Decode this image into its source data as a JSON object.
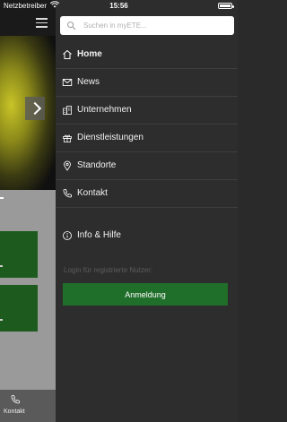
{
  "status_bar": {
    "carrier": "Netzbetreiber",
    "time": "15:56"
  },
  "background": {
    "tabbar": {
      "contact_label": "Kontakt"
    }
  },
  "drawer": {
    "search": {
      "placeholder": "Suchen in myETE..."
    },
    "menu_items": [
      {
        "label": "Home",
        "icon": "home-icon",
        "active": true
      },
      {
        "label": "News",
        "icon": "mail-icon",
        "active": false
      },
      {
        "label": "Unternehmen",
        "icon": "building-icon",
        "active": false
      },
      {
        "label": "Dienstleistungen",
        "icon": "gift-icon",
        "active": false
      },
      {
        "label": "Standorte",
        "icon": "location-pin-icon",
        "active": false
      },
      {
        "label": "Kontakt",
        "icon": "phone-icon",
        "active": false
      }
    ],
    "info_item": {
      "label": "Info & Hilfe",
      "icon": "info-icon"
    },
    "login_hint": "Login für registrierte Nutzer:",
    "login_button": "Anmeldung"
  },
  "colors": {
    "drawer_bg": "#2d2d2d",
    "accent_green": "#1f6e2a",
    "divider": "#3e3e3e"
  }
}
